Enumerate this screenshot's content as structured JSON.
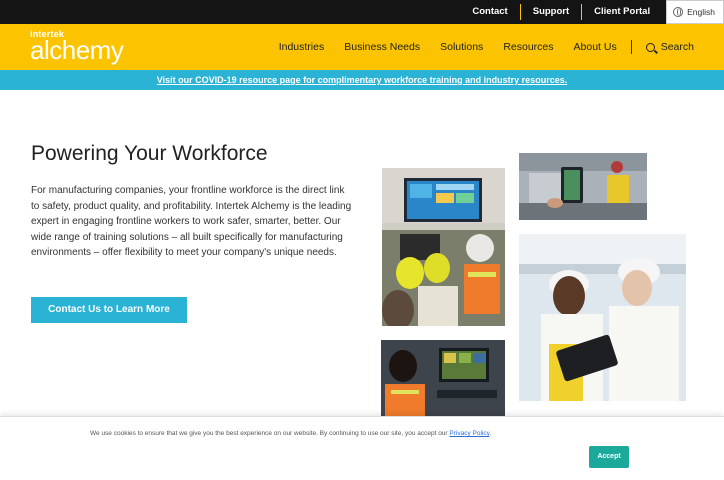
{
  "topbar": {
    "links": [
      "Contact",
      "Support",
      "Client Portal"
    ],
    "language": "English"
  },
  "header": {
    "logo_small": "intertek",
    "logo_big": "alchemy",
    "nav": [
      "Industries",
      "Business Needs",
      "Solutions",
      "Resources",
      "About Us"
    ],
    "search_label": "Search"
  },
  "banner": {
    "text": "Visit our COVID-19 resource page for complimentary workforce training and industry resources."
  },
  "hero": {
    "title": "Powering Your Workforce",
    "body": "For manufacturing companies, your frontline workforce is the direct link to safety, product quality, and profitability. Intertek Alchemy is the leading expert in engaging frontline workers to work safer, smarter, better. Our wide range of training solutions – all built specifically for manufacturing environments – offer flexibility to meet your company's unique needs.",
    "cta": "Contact Us to Learn More"
  },
  "cookie": {
    "text": "We use cookies to ensure that we give you the best experience on our website. By continuing to use our site, you accept our ",
    "link": "Privacy Policy",
    "tail": ".",
    "accept": "Accept"
  },
  "colors": {
    "brand_yellow": "#fcc400",
    "accent_blue": "#2bb3d6",
    "accept_green": "#1aa99a"
  }
}
